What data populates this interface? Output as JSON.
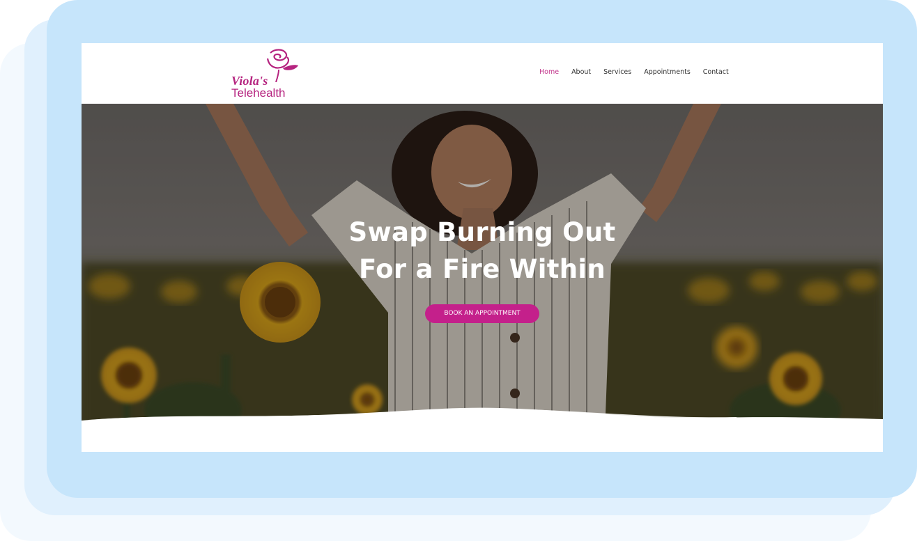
{
  "brand": {
    "name_line1": "Viola's",
    "name_line2": "Telehealth",
    "color": "#b5237f"
  },
  "nav": {
    "items": [
      {
        "label": "Home",
        "active": true
      },
      {
        "label": "About",
        "active": false
      },
      {
        "label": "Services",
        "active": false
      },
      {
        "label": "Appointments",
        "active": false
      },
      {
        "label": "Contact",
        "active": false
      }
    ],
    "active_color": "#c2338b"
  },
  "hero": {
    "title_line1": "Swap Burning Out",
    "title_line2": "For a Fire Within",
    "cta_label": "BOOK AN APPOINTMENT",
    "cta_color": "#c4208b",
    "image": "woman-with-raised-arms-in-sunflower-field"
  }
}
